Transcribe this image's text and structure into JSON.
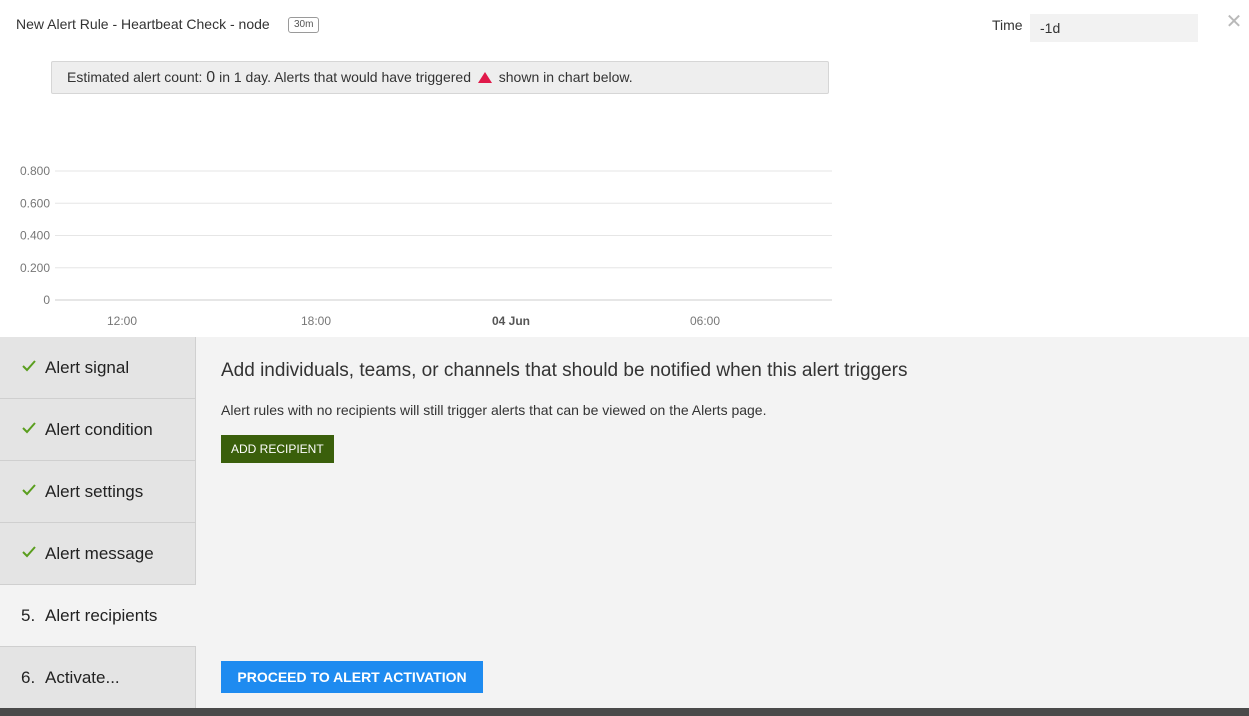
{
  "header": {
    "title": "New Alert Rule - Heartbeat Check - node",
    "badge": "30m",
    "time_label": "Time",
    "time_value": "-1d",
    "close_icon": "close-icon"
  },
  "estimate": {
    "prefix": "Estimated alert count:",
    "count": "0",
    "middle": "in 1 day. Alerts that would have triggered",
    "suffix": "shown in chart below.",
    "marker_color": "#e0194a"
  },
  "chart_data": {
    "type": "line",
    "title": "",
    "xlabel": "",
    "ylabel": "",
    "y_ticks": [
      "0.800",
      "0.600",
      "0.400",
      "0.200",
      "0"
    ],
    "ylim": [
      0,
      0.8
    ],
    "x_ticks": [
      "12:00",
      "18:00",
      "04 Jun",
      "06:00"
    ],
    "series": [],
    "grid": true
  },
  "steps": [
    {
      "label": "Alert signal",
      "status": "done"
    },
    {
      "label": "Alert condition",
      "status": "done"
    },
    {
      "label": "Alert settings",
      "status": "done"
    },
    {
      "label": "Alert message",
      "status": "done"
    },
    {
      "label": "Alert recipients",
      "num": "5.",
      "status": "active"
    },
    {
      "label": "Activate...",
      "num": "6.",
      "status": "pending"
    }
  ],
  "main": {
    "heading": "Add individuals, teams, or channels that should be notified when this alert triggers",
    "subtext": "Alert rules with no recipients will still trigger alerts that can be viewed on the Alerts page.",
    "add_button": "ADD RECIPIENT",
    "proceed_button": "PROCEED TO ALERT ACTIVATION"
  },
  "colors": {
    "check": "#5a9e1e",
    "add_button": "#3a5f0b",
    "proceed_button": "#1e8bf0"
  }
}
